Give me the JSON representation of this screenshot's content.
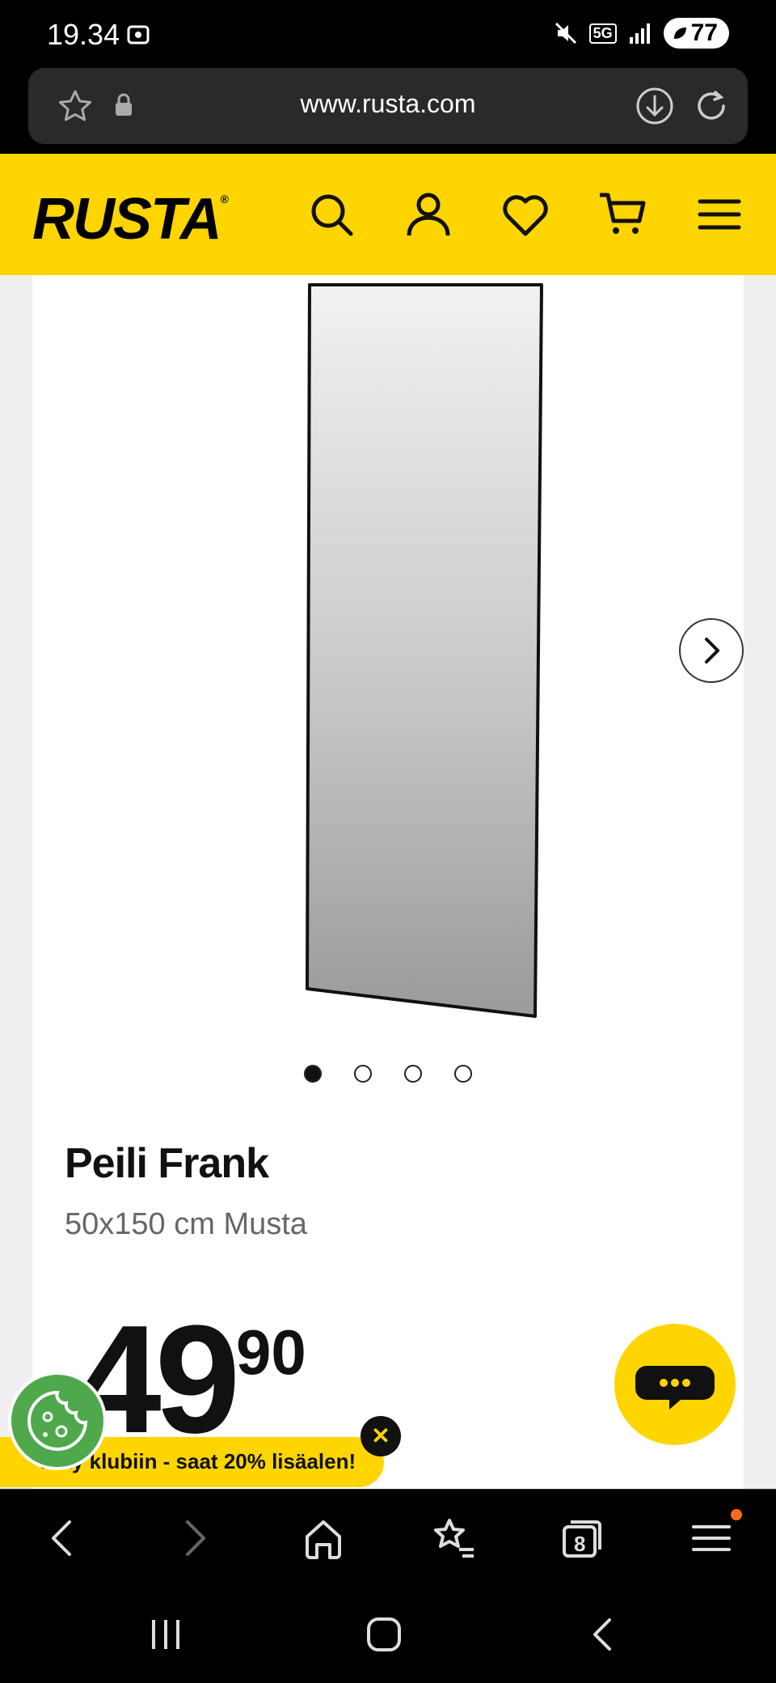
{
  "status": {
    "time": "19.34",
    "network": "5G",
    "battery": "77"
  },
  "browser": {
    "url": "www.rusta.com",
    "tabs_count": "8"
  },
  "header": {
    "logo": "RUSTA"
  },
  "product": {
    "title": "Peili Frank",
    "subtitle": "50x150 cm Musta",
    "price_integer": "49",
    "price_decimal": "90",
    "gallery": {
      "image_count": 4,
      "active_index": 0
    }
  },
  "promo": {
    "club_text": "Liity klubiin - saat 20% lisäalen!",
    "close_label": "✕"
  },
  "colors": {
    "brand_yellow": "#ffd500",
    "cookie_green": "#4fa84b",
    "badge_orange": "#ff6a1a"
  }
}
